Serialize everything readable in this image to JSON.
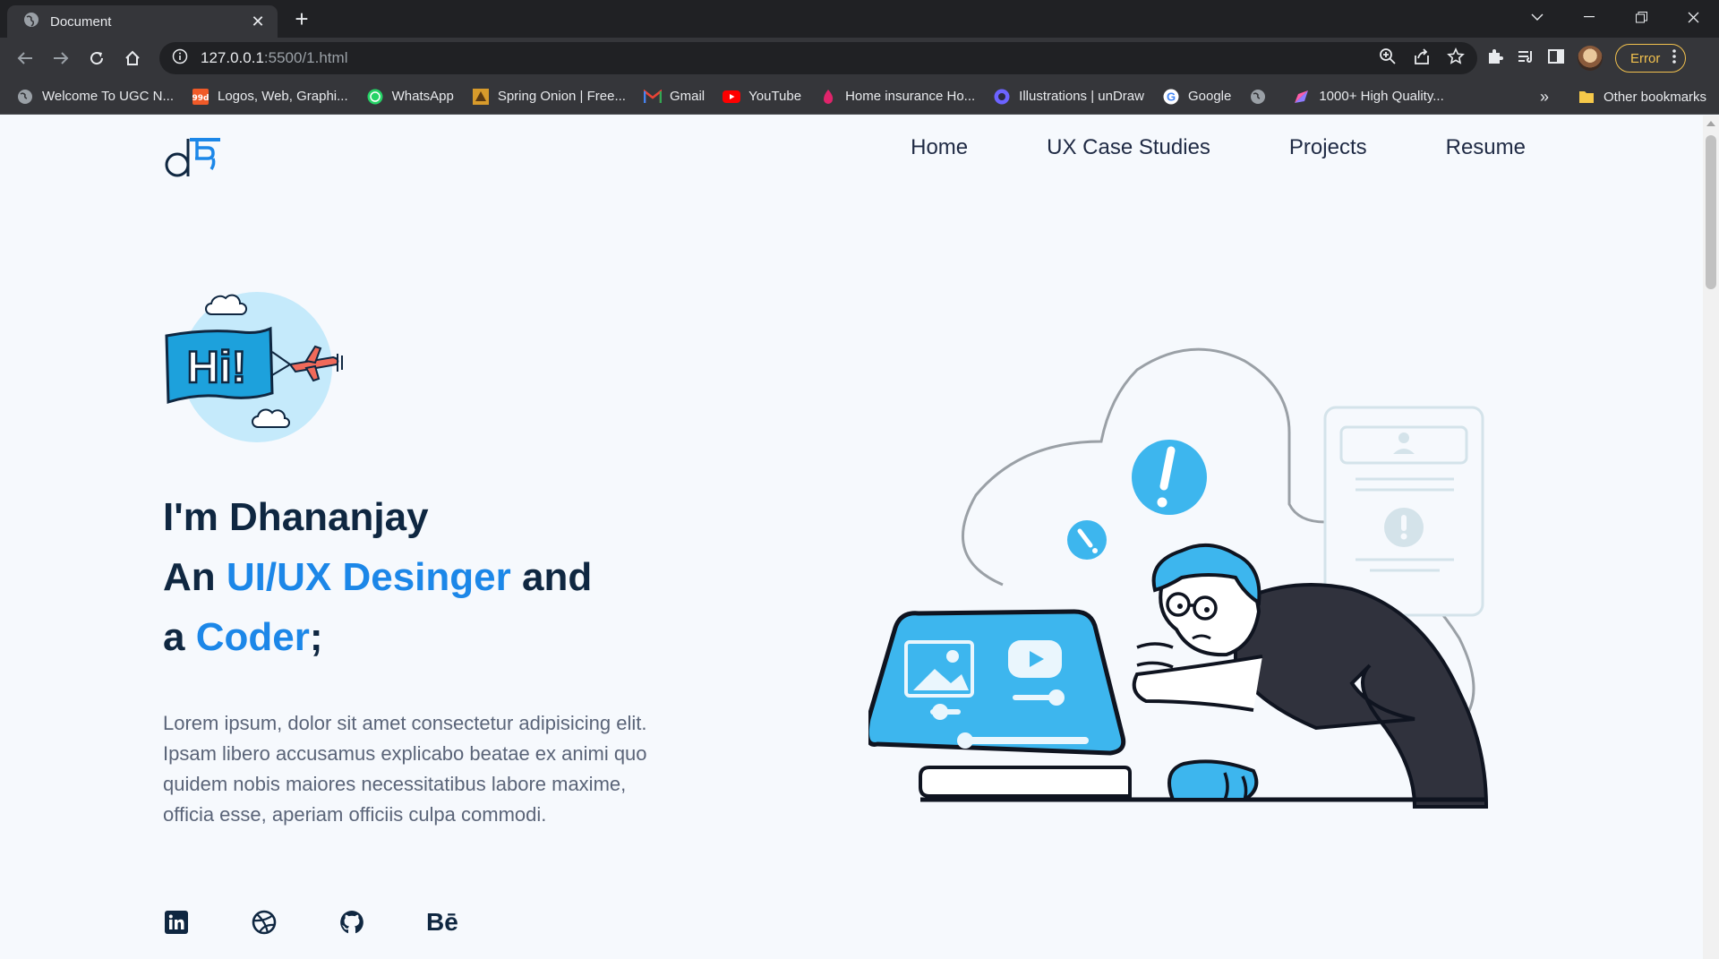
{
  "browser": {
    "tab_title": "Document",
    "url_host": "127.0.0.1",
    "url_rest": ":5500/1.html",
    "error_label": "Error",
    "bookmarks": [
      {
        "label": "Welcome To UGC N...",
        "icon": "globe-icon"
      },
      {
        "label": "Logos, Web, Graphi...",
        "icon": "99designs-icon"
      },
      {
        "label": "WhatsApp",
        "icon": "whatsapp-icon"
      },
      {
        "label": "Spring Onion | Free...",
        "icon": "spring-onion-icon"
      },
      {
        "label": "Gmail",
        "icon": "gmail-icon"
      },
      {
        "label": "YouTube",
        "icon": "youtube-icon"
      },
      {
        "label": "Home insurance Ho...",
        "icon": "flame-icon"
      },
      {
        "label": "Illustrations | unDraw",
        "icon": "undraw-icon"
      },
      {
        "label": "Google",
        "icon": "google-icon"
      },
      {
        "label": "",
        "icon": "globe-icon"
      },
      {
        "label": "1000+ High Quality...",
        "icon": "feather-icon"
      }
    ],
    "more_bookmarks": "»",
    "other_bookmarks": "Other bookmarks"
  },
  "page": {
    "nav": [
      "Home",
      "UX Case Studies",
      "Projects",
      "Resume"
    ],
    "hi_text": "Hi!",
    "headline": {
      "line1": "I'm Dhananjay",
      "line2_pre": "An ",
      "line2_accent": "UI/UX Desinger",
      "line2_post": " and",
      "line3_pre": "a ",
      "line3_accent": "Coder",
      "line3_post": ";"
    },
    "intro": "Lorem ipsum, dolor sit amet consectetur adipisicing elit. Ipsam libero accusamus explicabo beatae ex animi quo quidem nobis maiores necessitatibus labore maxime, officia esse, aperiam officiis culpa commodi.",
    "socials": [
      {
        "name": "linkedin-icon"
      },
      {
        "name": "dribbble-icon"
      },
      {
        "name": "github-icon"
      },
      {
        "name": "behance-icon",
        "label": "Bē"
      }
    ]
  },
  "colors": {
    "accent": "#1c87e8",
    "heading": "#0f2741",
    "illustration_blue": "#3db6ee",
    "background": "#f6f9fd"
  }
}
